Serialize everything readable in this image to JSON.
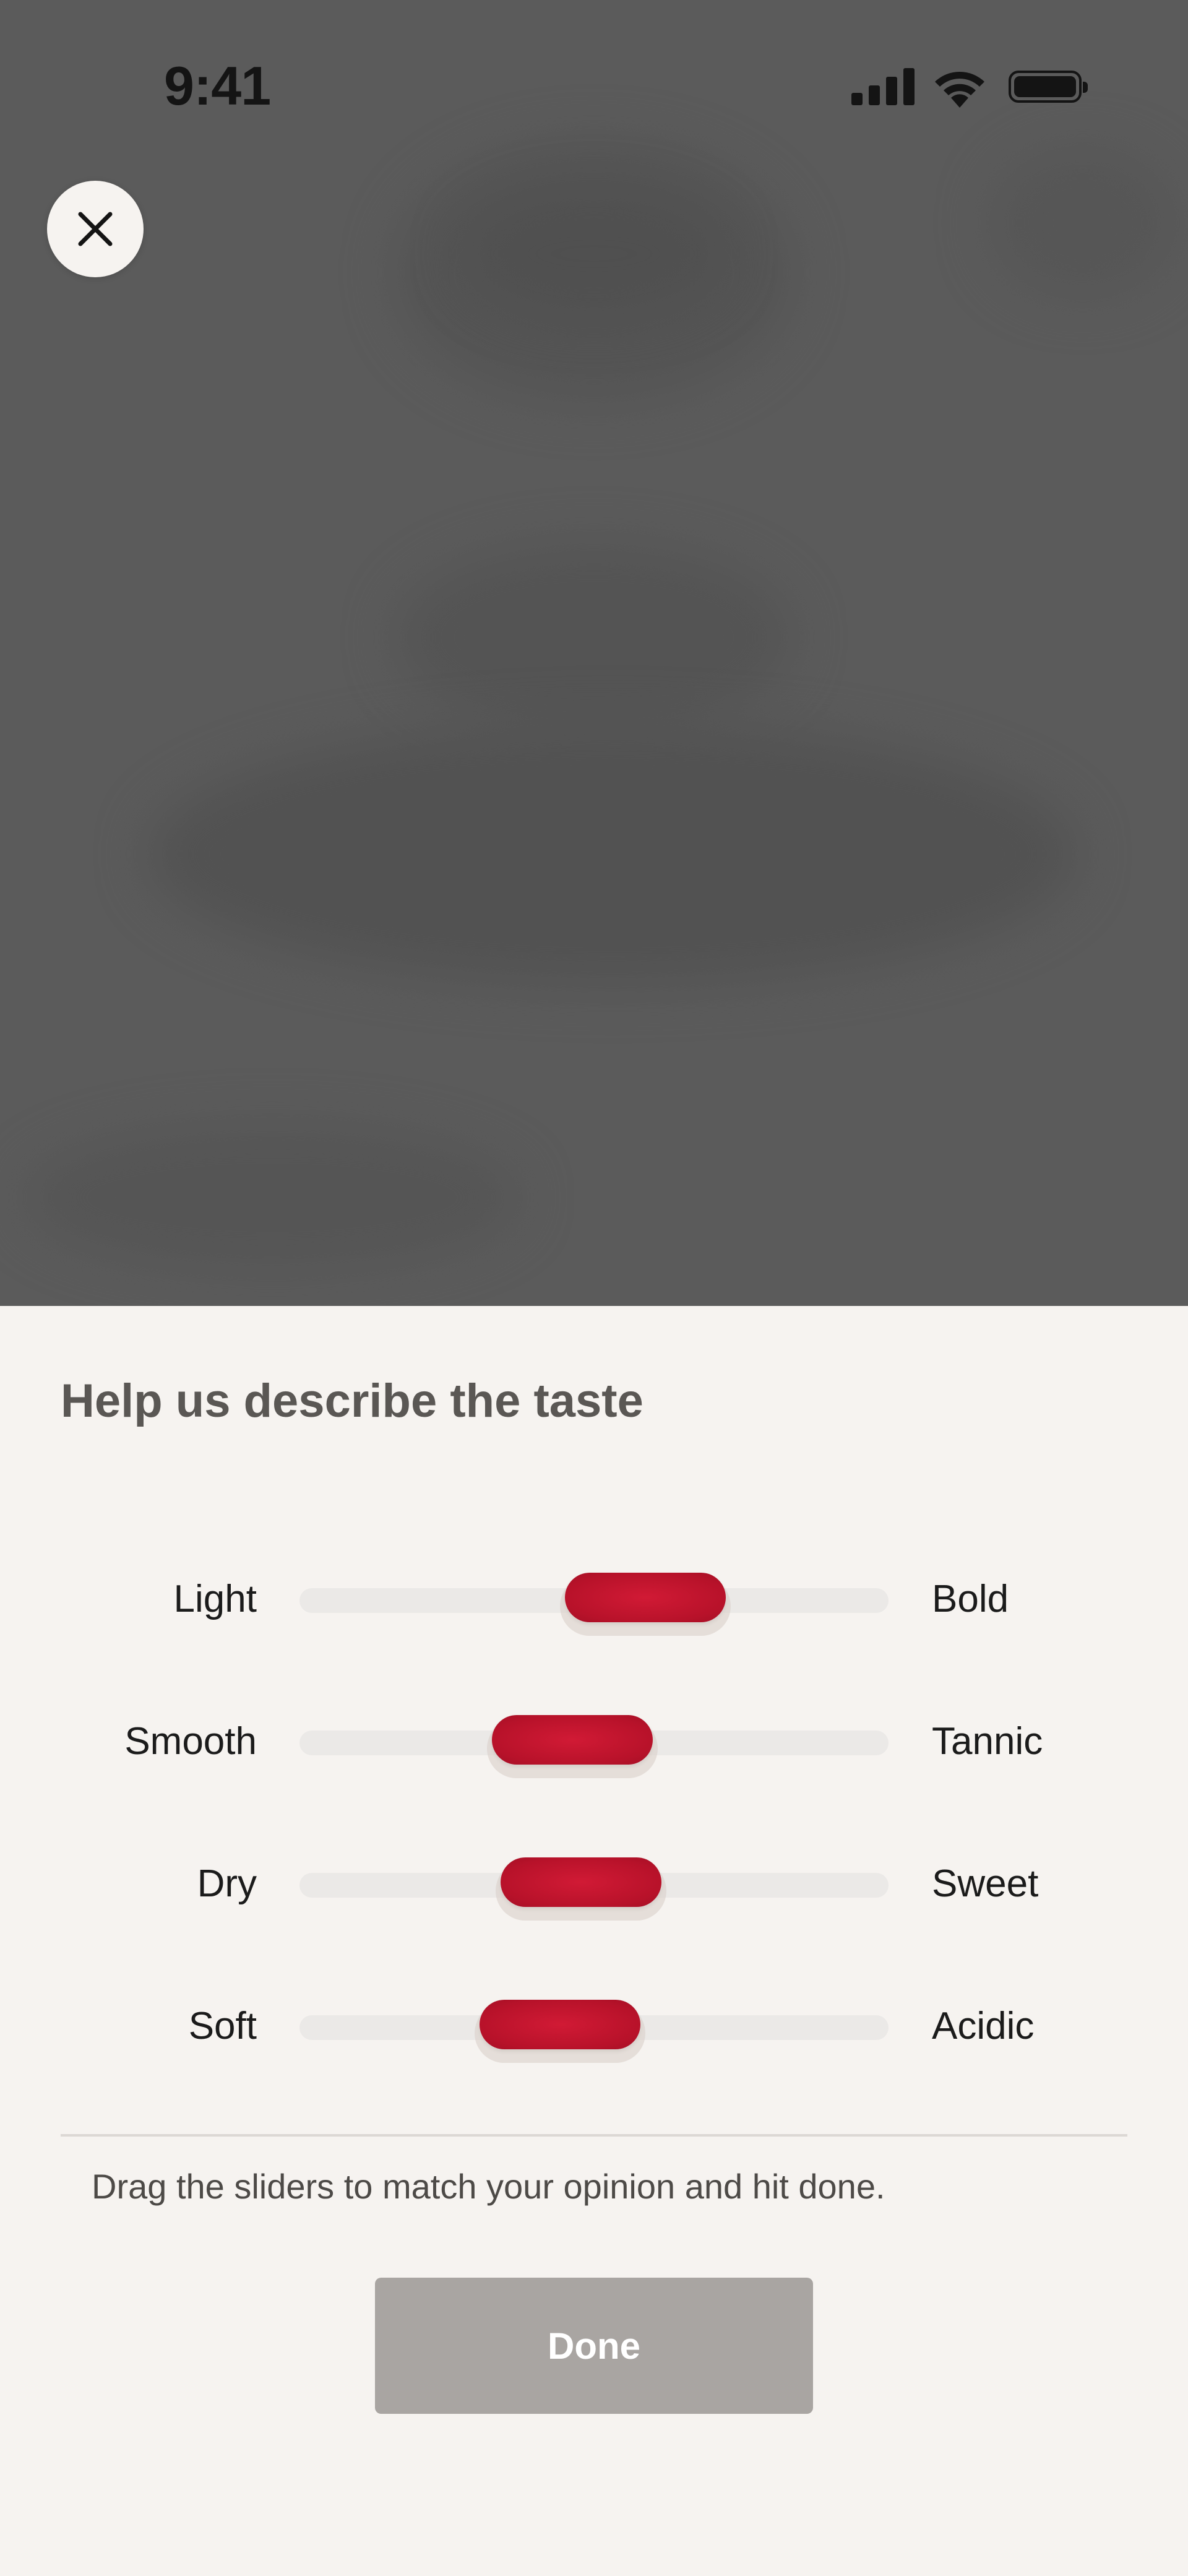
{
  "status_bar": {
    "time": "9:41",
    "icons": [
      "signal-icon",
      "wifi-icon",
      "battery-icon"
    ]
  },
  "close_button": {
    "icon": "close-icon"
  },
  "sheet": {
    "title": "Help us describe the taste",
    "sliders": [
      {
        "left_label": "Light",
        "right_label": "Bold",
        "value": 0.62
      },
      {
        "left_label": "Smooth",
        "right_label": "Tannic",
        "value": 0.45
      },
      {
        "left_label": "Dry",
        "right_label": "Sweet",
        "value": 0.47
      },
      {
        "left_label": "Soft",
        "right_label": "Acidic",
        "value": 0.42
      }
    ],
    "hint": "Drag the sliders to match your opinion and hit done.",
    "done_label": "Done"
  },
  "colors": {
    "backdrop": "#5b5b5b",
    "sheet_bg": "#f6f3f0",
    "thumb": "#c0142f",
    "track": "#ebe9e7",
    "done_disabled": "#a9a5a2"
  }
}
